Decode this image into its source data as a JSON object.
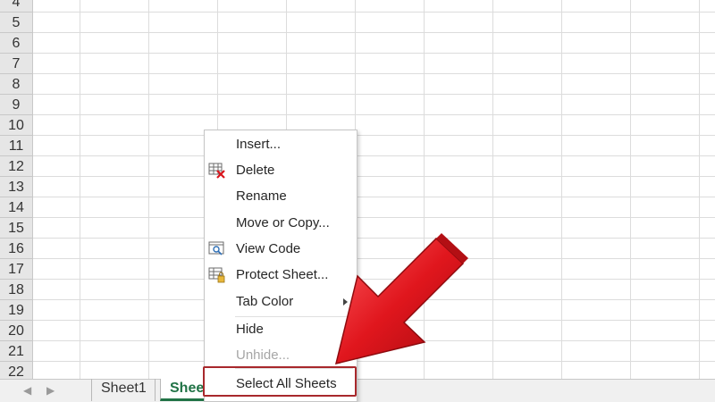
{
  "sheet": {
    "row_numbers": [
      "4",
      "5",
      "6",
      "7",
      "8",
      "9",
      "10",
      "11",
      "12",
      "13",
      "14",
      "15",
      "16",
      "17",
      "18",
      "19",
      "20",
      "21",
      "22"
    ]
  },
  "tabs": {
    "sheet1": "Sheet1",
    "active_partial": "Shee"
  },
  "context_menu": {
    "items": [
      {
        "label": "Insert...",
        "icon": ""
      },
      {
        "label": "Delete",
        "icon": "delete-sheet-icon"
      },
      {
        "label": "Rename",
        "icon": ""
      },
      {
        "label": "Move or Copy...",
        "icon": ""
      },
      {
        "label": "View Code",
        "icon": "view-code-icon"
      },
      {
        "label": "Protect Sheet...",
        "icon": "protect-sheet-icon"
      },
      {
        "label": "Tab Color",
        "icon": "",
        "submenu": true
      },
      {
        "label": "Hide",
        "icon": ""
      },
      {
        "label": "Unhide...",
        "icon": "",
        "disabled": true
      },
      {
        "label": "Select All Sheets",
        "icon": ""
      }
    ]
  },
  "colors": {
    "accent_green": "#217346",
    "highlight_red": "#a8282c",
    "arrow_red": "#d9141b"
  }
}
